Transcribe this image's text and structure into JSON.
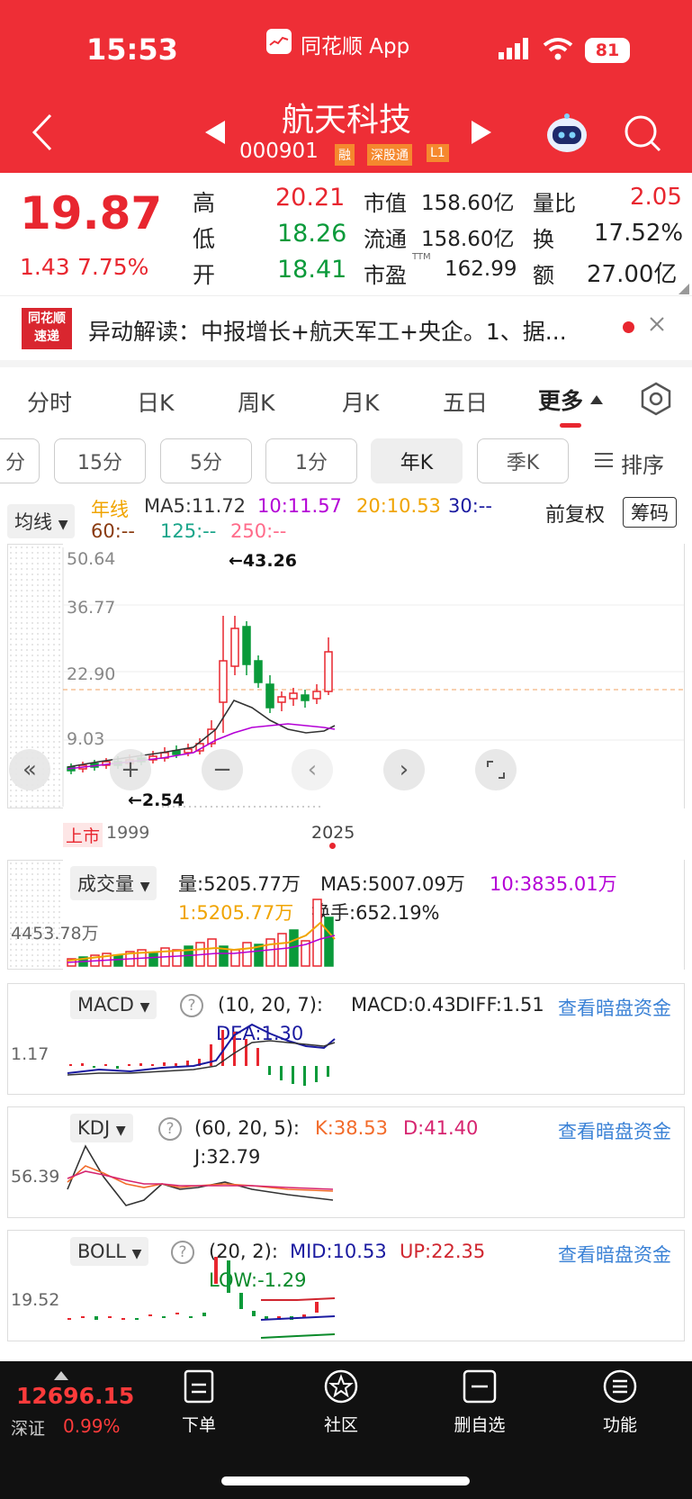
{
  "status_bar": {
    "time": "15:53",
    "app_name": "同花顺 App",
    "battery": "81"
  },
  "header": {
    "title": "航天科技",
    "code": "000901",
    "badges": [
      "融",
      "深股通",
      "L1"
    ]
  },
  "quote": {
    "price": "19.87",
    "change": "1.43",
    "change_pct": "7.75%",
    "stats": [
      {
        "label": "高",
        "value": "20.21",
        "color": "#e8262f"
      },
      {
        "label": "低",
        "value": "18.26",
        "color": "#0a9a3a"
      },
      {
        "label": "开",
        "value": "18.41",
        "color": "#0a9a3a"
      }
    ],
    "market_cap_label": "市值",
    "market_cap": "158.60亿",
    "float_label": "流通",
    "float_cap": "158.60亿",
    "pe_label": "市盈",
    "pe_sup": "TTM",
    "pe": "162.99",
    "vol_ratio_label": "量比",
    "vol_ratio": "2.05",
    "turnover_label": "换",
    "turnover": "17.52%",
    "amount_label": "额",
    "amount": "27.00亿"
  },
  "news": {
    "logo_top": "同花顺",
    "logo_bottom": "速递",
    "text": "异动解读：中报增长+航天军工+央企。1、据..."
  },
  "tabs": [
    "分时",
    "日K",
    "周K",
    "月K",
    "五日",
    "更多"
  ],
  "active_tab": "更多",
  "subtabs": [
    "分",
    "15分",
    "5分",
    "1分",
    "年K",
    "季K"
  ],
  "sort_label": "排序",
  "ma": {
    "select": "均线",
    "label": "年线",
    "ma5": "MA5:11.72",
    "ma10": "10:11.57",
    "ma20": "20:10.53",
    "ma30": "30:--",
    "ma60": "60:--",
    "ma125": "125:--",
    "ma250": "250:--",
    "fuquan": "前复权",
    "chip": "筹码"
  },
  "kchart": {
    "y_labels": [
      "50.64",
      "36.77",
      "22.90",
      "9.03"
    ],
    "max_label": "←43.26",
    "min_label": "←2.54",
    "x_left": "1999",
    "x_right": "2025",
    "listing": "上市"
  },
  "colors": {
    "up": "#e8262f",
    "down": "#0a9a3a",
    "ma5": "#333333",
    "ma10": "#b400d6",
    "ma20": "#f0a400",
    "ma30": "#1a1aa0",
    "link": "#3b82d6",
    "header": "#ee2e36"
  },
  "volume": {
    "select": "成交量",
    "vol": "量:5205.77万",
    "ma5": "MA5:5007.09万",
    "ma10": "10:3835.01万",
    "ma1": "1:5205.77万",
    "turnover": "换手:652.19%",
    "y_label": "4453.78万"
  },
  "macd": {
    "select": "MACD",
    "params": "(10, 20, 7):",
    "macd": "MACD:0.43",
    "diff": "DIFF:1.51",
    "dea": "DEA:1.30",
    "link": "查看暗盘资金",
    "y_label": "1.17"
  },
  "kdj": {
    "select": "KDJ",
    "params": "(60, 20, 5):",
    "k": "K:38.53",
    "d": "D:41.40",
    "j": "J:32.79",
    "link": "查看暗盘资金",
    "y_label": "56.39"
  },
  "boll": {
    "select": "BOLL",
    "params": "(20, 2):",
    "mid": "MID:10.53",
    "up": "UP:22.35",
    "low": "LOW:-1.29",
    "link": "查看暗盘资金",
    "y_label": "19.52"
  },
  "bottom_bar": {
    "index_value": "12696.15",
    "index_name": "深证",
    "index_pct": "0.99%",
    "items": [
      "下单",
      "社区",
      "删自选",
      "功能"
    ]
  }
}
